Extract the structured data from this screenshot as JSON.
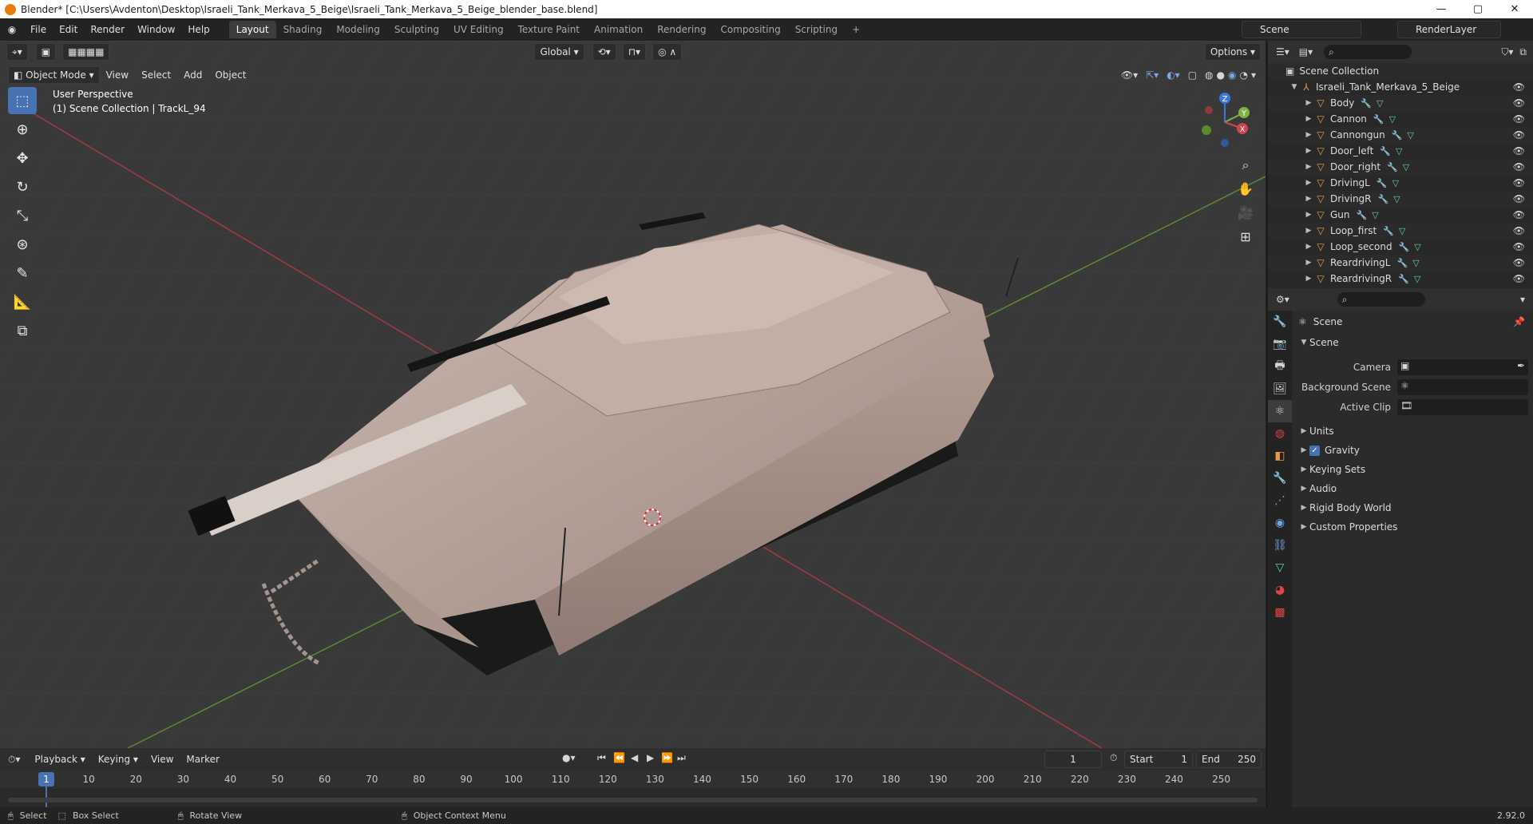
{
  "window": {
    "title": "Blender* [C:\\Users\\Avdenton\\Desktop\\Israeli_Tank_Merkava_5_Beige\\Israeli_Tank_Merkava_5_Beige_blender_base.blend]",
    "minimize": "—",
    "maximize": "▢",
    "close": "✕"
  },
  "menubar": [
    "File",
    "Edit",
    "Render",
    "Window",
    "Help"
  ],
  "workspaces": [
    "Layout",
    "Shading",
    "Modeling",
    "Sculpting",
    "UV Editing",
    "Texture Paint",
    "Animation",
    "Rendering",
    "Compositing",
    "Scripting"
  ],
  "add_workspace": "+",
  "scene_name": "Scene",
  "render_layer": "RenderLayer",
  "viewport": {
    "orientation": "Global",
    "options": "Options",
    "mode": "Object Mode",
    "menus": [
      "View",
      "Select",
      "Add",
      "Object"
    ],
    "info_line1": "User Perspective",
    "info_line2": "(1) Scene Collection | TrackL_94",
    "axis_x": "X",
    "axis_y": "Y",
    "axis_z": "Z"
  },
  "outliner": {
    "root": "Scene Collection",
    "collection": "Israeli_Tank_Merkava_5_Beige",
    "objects": [
      "Body",
      "Cannon",
      "Cannongun",
      "Door_left",
      "Door_right",
      "DrivingL",
      "DrivingR",
      "Gun",
      "Loop_first",
      "Loop_second",
      "ReardrivingL",
      "ReardrivingR"
    ]
  },
  "properties": {
    "context": "Scene",
    "section": "Scene",
    "fields": [
      {
        "label": "Camera"
      },
      {
        "label": "Background Scene"
      },
      {
        "label": "Active Clip"
      }
    ],
    "panels": [
      "Units",
      "Gravity",
      "Keying Sets",
      "Audio",
      "Rigid Body World",
      "Custom Properties"
    ]
  },
  "timeline": {
    "menus": [
      "Playback",
      "Keying",
      "View",
      "Marker"
    ],
    "current_frame": "1",
    "start_label": "Start",
    "start": "1",
    "end_label": "End",
    "end": "250",
    "ruler": [
      "1",
      "10",
      "20",
      "30",
      "40",
      "50",
      "60",
      "70",
      "80",
      "90",
      "100",
      "110",
      "120",
      "130",
      "140",
      "150",
      "160",
      "170",
      "180",
      "190",
      "200",
      "210",
      "220",
      "230",
      "240",
      "250"
    ]
  },
  "statusbar": {
    "select": "Select",
    "box_select": "Box Select",
    "rotate_view": "Rotate View",
    "context_menu": "Object Context Menu",
    "version": "2.92.0"
  },
  "colors": {
    "accent": "#4772b3",
    "object_orange": "#e89a3c",
    "axis_red": "#d2444b",
    "axis_green": "#7cb342",
    "axis_blue": "#3a78d8",
    "tank_beige": "#b9a49b"
  }
}
